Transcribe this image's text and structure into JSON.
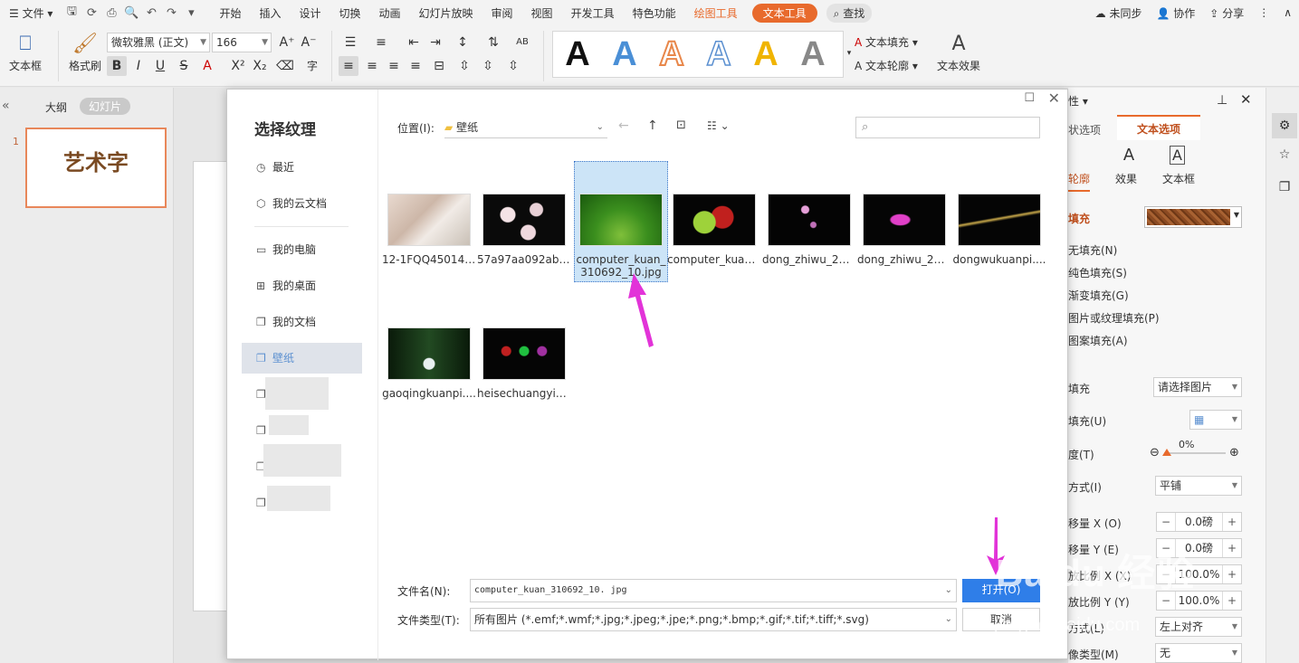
{
  "menubar": {
    "file": "文件",
    "tabs": [
      "开始",
      "插入",
      "设计",
      "切换",
      "动画",
      "幻灯片放映",
      "审阅",
      "视图",
      "开发工具",
      "特色功能"
    ],
    "drawing_tools": "绘图工具",
    "text_tools": "文本工具",
    "search": "查找",
    "unsynced": "未同步",
    "collab": "协作",
    "share": "分享"
  },
  "ribbon": {
    "textbox": "文本框",
    "format_painter": "格式刷",
    "font": "微软雅黑 (正文)",
    "size": "166",
    "text_fill": "文本填充",
    "text_outline": "文本轮廓",
    "text_effects": "文本效果",
    "gallery_letter": "A"
  },
  "leftpanel": {
    "outline": "大纲",
    "slides": "幻灯片",
    "slide_number": "1",
    "thumb_text": "艺术字"
  },
  "dialog": {
    "title": "选择纹理",
    "nav": [
      "最近",
      "我的云文档",
      "我的电脑",
      "我的桌面",
      "我的文档",
      "壁纸"
    ],
    "blurred_suffix": "..",
    "location_label": "位置(I):",
    "location_value": "壁纸",
    "files": [
      {
        "name": "12-1FQQ45014...."
      },
      {
        "name": "57a97aa092ab...."
      },
      {
        "name": "computer_kuan_310692_10.jpg"
      },
      {
        "name": "computer_kuan...."
      },
      {
        "name": "dong_zhiwu_24...."
      },
      {
        "name": "dong_zhiwu_24...."
      },
      {
        "name": "dongwukuanpi...."
      },
      {
        "name": "gaoqingkuanpi...."
      },
      {
        "name": "heisechuangyib...."
      }
    ],
    "filename_label": "文件名(N):",
    "filename_value": "computer_kuan_310692_10. jpg",
    "filetype_label": "文件类型(T):",
    "filetype_value": "所有图片 (*.emf;*.wmf;*.jpg;*.jpeg;*.jpe;*.png;*.bmp;*.gif;*.tif;*.tiff;*.svg)",
    "open": "打开(O)",
    "cancel": "取消"
  },
  "rightpanel": {
    "header": "性",
    "tab_shape": "状选项",
    "tab_text": "文本选项",
    "sub_outline": "轮廓",
    "sub_effects": "效果",
    "sub_textbox": "文本框",
    "fill": "填充",
    "no_fill": "无填充(N)",
    "solid_fill": "纯色填充(S)",
    "gradient_fill": "渐变填充(G)",
    "picture_fill": "图片或纹理填充(P)",
    "pattern_fill": "图案填充(A)",
    "fill_source_label": "填充",
    "fill_source_value": "请选择图片",
    "texture_label": "填充(U)",
    "transparency_label": "度(T)",
    "transparency_value": "0%",
    "mode_label": "方式(I)",
    "mode_value": "平铺",
    "offset_x_label": "移量 X (O)",
    "offset_x_value": "0.0磅",
    "offset_y_label": "移量 Y (E)",
    "offset_y_value": "0.0磅",
    "scale_x_label": "放比例 X (X)",
    "scale_x_value": "100.0%",
    "scale_y_label": "放比例 Y (Y)",
    "scale_y_value": "100.0%",
    "align_label": "方式(L)",
    "align_value": "左上对齐",
    "mirror_label": "像类型(M)",
    "mirror_value": "无"
  },
  "watermark": "Baidu 经验",
  "watermark_url": "jingyan.baidu.com",
  "colors": {
    "accent": "#e86a2c",
    "select_blue": "#cce4f7",
    "open_blue": "#2f7ee8",
    "arrow": "#e233d8"
  }
}
